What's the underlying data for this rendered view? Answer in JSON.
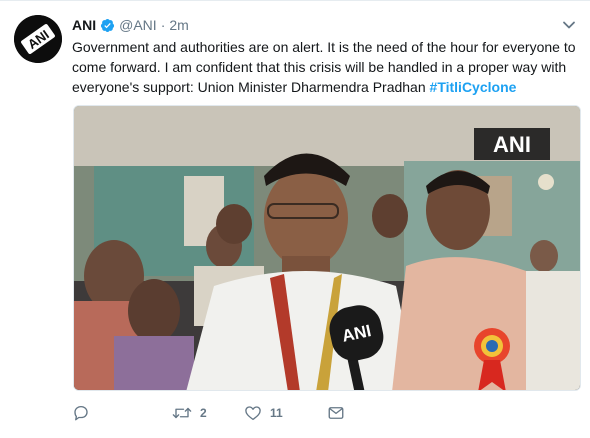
{
  "tweet": {
    "author_name": "ANI",
    "author_handle": "@ANI",
    "separator": "·",
    "timestamp": "2m",
    "text_main": "Government and authorities are on alert. It is the need of the hour for everyone to come forward. I am confident that this crisis will be handled in a proper way with everyone's support: Union Minister Dharmendra Pradhan ",
    "hashtag": "#TitliCyclone",
    "media": {
      "watermark": "ANI",
      "mic_label": "ANI"
    },
    "actions": {
      "replies": "",
      "retweets": "2",
      "likes": "11"
    },
    "avatar_text": "ANI"
  },
  "colors": {
    "accent": "#1da1f2",
    "muted": "#657786",
    "text": "#14171a"
  },
  "icons": [
    "verified-badge-icon",
    "chevron-down-icon",
    "reply-icon",
    "retweet-icon",
    "like-icon",
    "direct-message-icon"
  ]
}
